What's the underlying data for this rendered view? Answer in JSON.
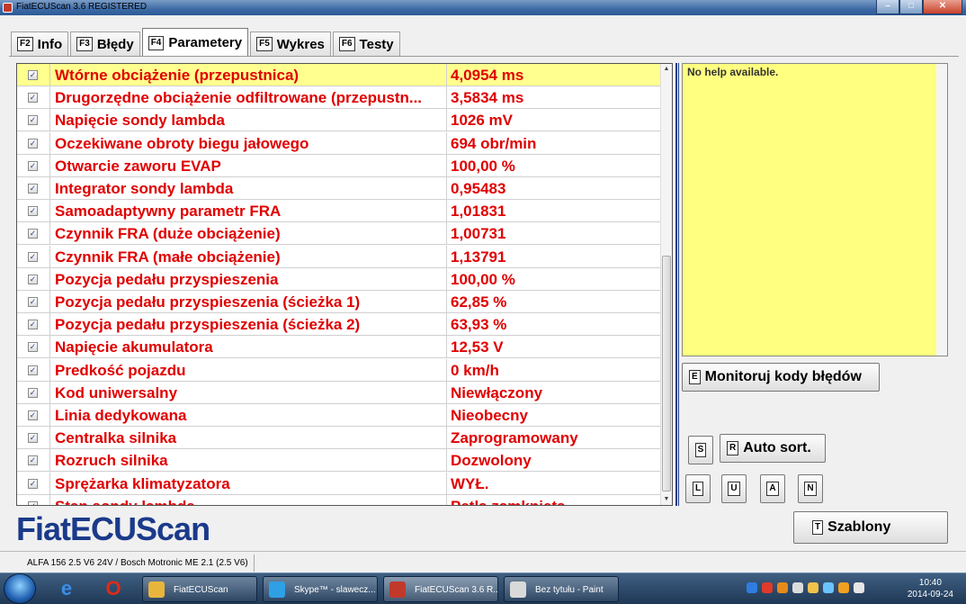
{
  "window": {
    "title": "FiatECUScan 3.6 REGISTERED"
  },
  "tabs": [
    {
      "key": "F2",
      "label": "Info",
      "active": false
    },
    {
      "key": "F3",
      "label": "Błędy",
      "active": false
    },
    {
      "key": "F4",
      "label": "Parametery",
      "active": true
    },
    {
      "key": "F5",
      "label": "Wykres",
      "active": false
    },
    {
      "key": "F6",
      "label": "Testy",
      "active": false
    }
  ],
  "parameters": [
    {
      "name": "Wtórne obciążenie (przepustnica)",
      "value": "4,0954 ms",
      "checked": true,
      "selected": true
    },
    {
      "name": "Drugorzędne obciążenie odfiltrowane (przepustn...",
      "value": "3,5834 ms",
      "checked": true
    },
    {
      "name": "Napięcie sondy lambda",
      "value": "1026 mV",
      "checked": true
    },
    {
      "name": "Oczekiwane obroty biegu jałowego",
      "value": "694 obr/min",
      "checked": true
    },
    {
      "name": "Otwarcie zaworu EVAP",
      "value": "100,00 %",
      "checked": true
    },
    {
      "name": "Integrator sondy lambda",
      "value": "0,95483",
      "checked": true
    },
    {
      "name": "Samoadaptywny parametr FRA",
      "value": "1,01831",
      "checked": true
    },
    {
      "name": "Czynnik FRA (duże obciążenie)",
      "value": "1,00731",
      "checked": true
    },
    {
      "name": "Czynnik FRA (małe obciążenie)",
      "value": "1,13791",
      "checked": true
    },
    {
      "name": "Pozycja pedału przyspieszenia",
      "value": "100,00 %",
      "checked": true
    },
    {
      "name": "Pozycja pedału przyspieszenia (ścieżka 1)",
      "value": "62,85 %",
      "checked": true
    },
    {
      "name": "Pozycja pedału przyspieszenia (ścieżka 2)",
      "value": "63,93 %",
      "checked": true
    },
    {
      "name": "Napięcie akumulatora",
      "value": "12,53 V",
      "checked": true
    },
    {
      "name": "Predkość pojazdu",
      "value": "0 km/h",
      "checked": true
    },
    {
      "name": "Kod uniwersalny",
      "value": "Niewłączony",
      "checked": true
    },
    {
      "name": "Linia dedykowana",
      "value": "Nieobecny",
      "checked": true
    },
    {
      "name": "Centralka silnika",
      "value": "Zaprogramowany",
      "checked": true
    },
    {
      "name": "Rozruch silnika",
      "value": "Dozwolony",
      "checked": true
    },
    {
      "name": "Sprężarka klimatyzatora",
      "value": "WYŁ.",
      "checked": true
    },
    {
      "name": "Stan sondy lambda",
      "value": "Pętla zamknięta",
      "checked": true
    }
  ],
  "help": {
    "text": "No help available."
  },
  "buttons": {
    "monitor": {
      "key": "E",
      "label": "Monitoruj kody błędów"
    },
    "s": {
      "key": "S"
    },
    "autosort": {
      "key": "R",
      "label": "Auto sort."
    },
    "l": {
      "key": "L"
    },
    "u": {
      "key": "U"
    },
    "a": {
      "key": "A"
    },
    "n": {
      "key": "N"
    },
    "templates": {
      "key": "T",
      "label": "Szablony"
    }
  },
  "logo": "FiatECUScan",
  "status": {
    "vehicle": "ALFA 156 2.5 V6 24V / Bosch Motronic ME 2.1 (2.5 V6)"
  },
  "taskbar": {
    "items": [
      {
        "label": "FiatECUScan",
        "color": "#e7b53c"
      },
      {
        "label": "Skype™ - slawecz...",
        "color": "#2fa0e6"
      },
      {
        "label": "FiatECUScan 3.6 R...",
        "color": "#c0392b"
      },
      {
        "label": "Bez tytułu - Paint",
        "color": "#d9d9d9"
      }
    ],
    "clock": {
      "time": "10:40",
      "date": "2014-09-24"
    }
  }
}
